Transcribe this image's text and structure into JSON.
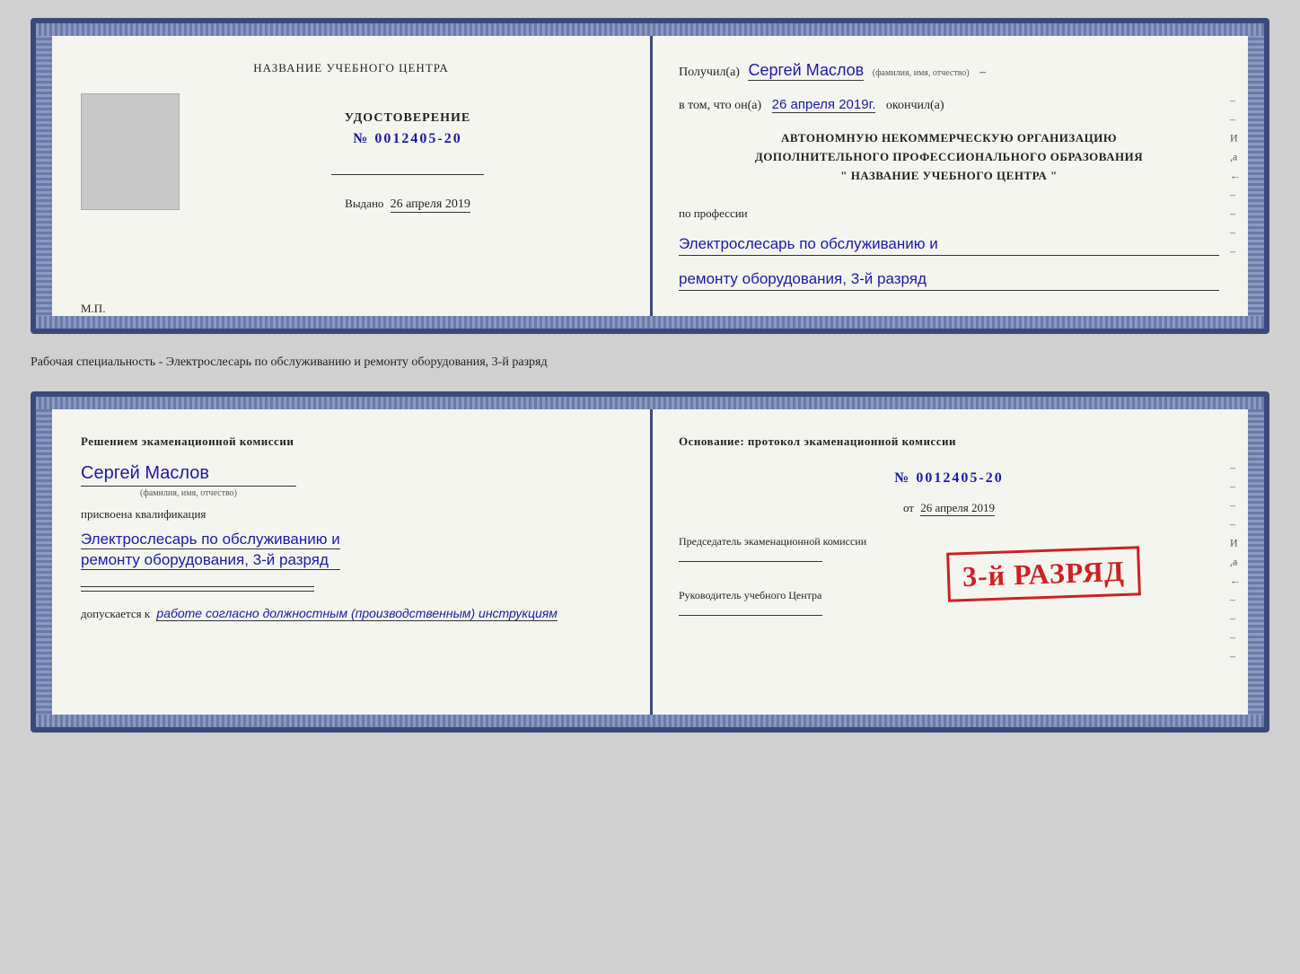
{
  "card1": {
    "left": {
      "training_center_label": "НАЗВАНИЕ УЧЕБНОГО ЦЕНТРА",
      "certificate_label": "УДОСТОВЕРЕНИЕ",
      "certificate_number": "№ 0012405-20",
      "issued_label": "Выдано",
      "issued_date": "26 апреля 2019",
      "mp_label": "М.П."
    },
    "right": {
      "received_label": "Получил(а)",
      "recipient_name": "Сергей Маслов",
      "fio_hint": "(фамилия, имя, отчество)",
      "in_that_label": "в том, что он(а)",
      "in_that_date": "26 апреля 2019г.",
      "finished_label": "окончил(а)",
      "org_line1": "АВТОНОМНУЮ НЕКОММЕРЧЕСКУЮ ОРГАНИЗАЦИЮ",
      "org_line2": "ДОПОЛНИТЕЛЬНОГО ПРОФЕССИОНАЛЬНОГО ОБРАЗОВАНИЯ",
      "org_line3": "\" НАЗВАНИЕ УЧЕБНОГО ЦЕНТРА \"",
      "profession_label": "по профессии",
      "profession_line1": "Электрослесарь по обслуживанию и",
      "profession_line2": "ремонту оборудования, 3-й разряд"
    }
  },
  "between_text": "Рабочая специальность - Электрослесарь по обслуживанию и ремонту оборудования, 3-й разряд",
  "card2": {
    "left": {
      "decision_text": "Решением экаменационной комиссии",
      "person_name": "Сергей Маслов",
      "fio_hint": "(фамилия, имя, отчество)",
      "assigned_text": "присвоена квалификация",
      "qualification_line1": "Электрослесарь по обслуживанию и",
      "qualification_line2": "ремонту оборудования, 3-й разряд",
      "allowed_label": "допускается к",
      "allowed_value": "работе согласно должностным (производственным) инструкциям"
    },
    "right": {
      "basis_label": "Основание: протокол экаменационной комиссии",
      "number_value": "№ 0012405-20",
      "date_label": "от",
      "date_value": "26 апреля 2019",
      "chairman_label": "Председатель экаменационной комиссии",
      "ruler_label": "Руководитель учебного Центра"
    },
    "stamp": {
      "text": "3-й РАЗРЯД"
    }
  }
}
